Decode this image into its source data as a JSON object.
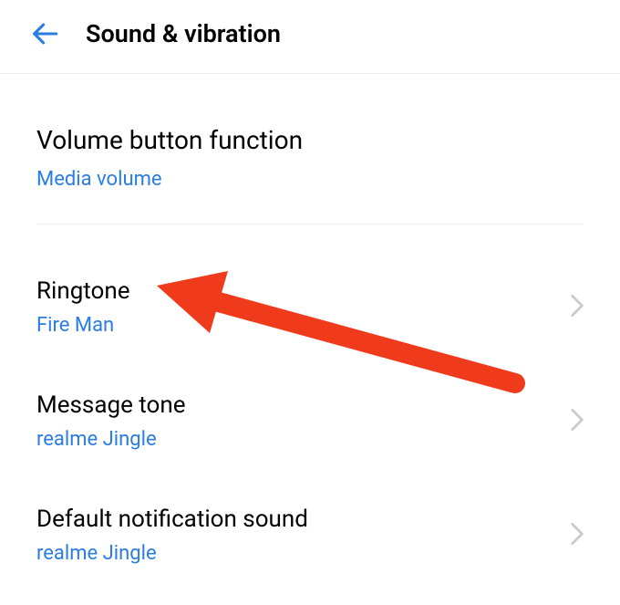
{
  "header": {
    "title": "Sound & vibration"
  },
  "volume_button": {
    "label": "Volume button function",
    "value": "Media volume"
  },
  "items": [
    {
      "label": "Ringtone",
      "value": "Fire Man"
    },
    {
      "label": "Message tone",
      "value": "realme Jingle"
    },
    {
      "label": "Default notification sound",
      "value": "realme Jingle"
    }
  ],
  "colors": {
    "accent": "#2a7de1",
    "annotation": "#f03a1c"
  }
}
